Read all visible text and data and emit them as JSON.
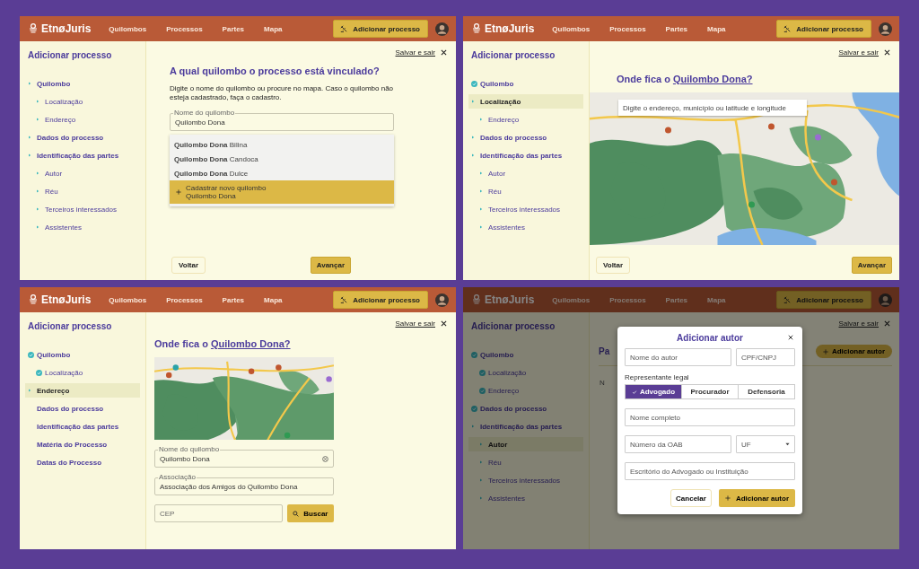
{
  "screens": [
    {
      "dimmed": false,
      "header": {
        "logo": "EtnøJuris",
        "nav": [
          "Quilombos",
          "Processos",
          "Partes",
          "Mapa"
        ],
        "action": "Adicionar processo"
      },
      "sidebar": {
        "title": "Adicionar processo",
        "steps": [
          {
            "label": "Quilombo",
            "kind": "pending",
            "selected": false,
            "children": [
              {
                "label": "Localização",
                "kind": "pending",
                "selected": false
              },
              {
                "label": "Endereço",
                "kind": "pending",
                "selected": false
              }
            ]
          },
          {
            "label": "Dados do processo",
            "kind": "pending",
            "selected": false
          },
          {
            "label": "Identificação das partes",
            "kind": "pending",
            "selected": false,
            "children": [
              {
                "label": "Autor",
                "kind": "pending",
                "selected": false
              },
              {
                "label": "Réu",
                "kind": "pending",
                "selected": false
              },
              {
                "label": "Terceiros interessados",
                "kind": "pending",
                "selected": false
              },
              {
                "label": "Assistentes",
                "kind": "pending",
                "selected": false
              }
            ]
          }
        ]
      },
      "save_exit": "Salvar e sair",
      "content": {
        "kind": "search",
        "heading": "A qual quilombo o processo está vinculado?",
        "description": "Digite o nome do quilombo ou procure no mapa. Caso o quilombo não esteja cadastrado, faça o cadastro.",
        "field": {
          "label": "Nome do quilombo",
          "value": "Quilombo Dona"
        },
        "suggestions": [
          "**Quilombo Dona** Bilina",
          "**Quilombo Dona** Candoca",
          "**Quilombo Dona** Dulce"
        ],
        "create": {
          "caption": "Cadastrar novo quilombo",
          "value": "Quilombo Dona"
        },
        "back": "Voltar",
        "next": "Avançar"
      }
    },
    {
      "dimmed": false,
      "header": {
        "logo": "EtnøJuris",
        "nav": [
          "Quilombos",
          "Processos",
          "Partes",
          "Mapa"
        ],
        "action": "Adicionar processo"
      },
      "sidebar": {
        "title": "Adicionar processo",
        "steps": [
          {
            "label": "Quilombo",
            "kind": "done",
            "selected": false
          },
          {
            "label": "Localização",
            "kind": "pending",
            "selected": true,
            "children": [
              {
                "label": "Endereço",
                "kind": "pending",
                "selected": false
              }
            ]
          },
          {
            "label": "Dados do processo",
            "kind": "pending",
            "selected": false
          },
          {
            "label": "Identificação das partes",
            "kind": "pending",
            "selected": false,
            "children": [
              {
                "label": "Autor",
                "kind": "pending",
                "selected": false
              },
              {
                "label": "Réu",
                "kind": "pending",
                "selected": false
              },
              {
                "label": "Terceiros interessados",
                "kind": "pending",
                "selected": false
              },
              {
                "label": "Assistentes",
                "kind": "pending",
                "selected": false
              }
            ]
          }
        ]
      },
      "save_exit": "Salvar e sair",
      "content": {
        "kind": "map",
        "heading": "Onde fica o",
        "link": "Quilombo Dona?",
        "map_search": {
          "placeholder": "Digite o endereço, município ou latitude e longitude"
        },
        "back": "Voltar",
        "next": "Avançar"
      }
    },
    {
      "dimmed": false,
      "header": {
        "logo": "EtnøJuris",
        "nav": [
          "Quilombos",
          "Processos",
          "Partes",
          "Mapa"
        ],
        "action": "Adicionar processo"
      },
      "sidebar": {
        "title": "Adicionar processo",
        "steps": [
          {
            "label": "Quilombo",
            "kind": "done",
            "selected": false,
            "children": [
              {
                "label": "Localização",
                "kind": "done",
                "selected": false
              }
            ]
          },
          {
            "label": "Endereço",
            "kind": "pending",
            "selected": true
          },
          {
            "label": "Dados do processo",
            "kind": "plain",
            "selected": false
          },
          {
            "label": "Identificação das partes",
            "kind": "plain",
            "selected": false
          },
          {
            "label": "Matéria do Processo",
            "kind": "plain",
            "selected": false
          },
          {
            "label": "Datas do Processo",
            "kind": "plain",
            "selected": false
          }
        ]
      },
      "save_exit": "Salvar e sair",
      "content": {
        "kind": "address",
        "heading": "Onde fica o",
        "link": "Quilombo Dona?",
        "name_field": {
          "label": "Nome do quilombo",
          "value": "Quilombo Dona"
        },
        "association_field": {
          "label": "Associação",
          "value": "Associação dos Amigos do Quilombo Dona"
        },
        "cep_field": {
          "placeholder": "CEP"
        },
        "search_button": "Buscar"
      }
    },
    {
      "dimmed": true,
      "header": {
        "logo": "EtnøJuris",
        "nav": [
          "Quilombos",
          "Processos",
          "Partes",
          "Mapa"
        ],
        "action": "Adicionar processo"
      },
      "sidebar": {
        "title": "Adicionar processo",
        "steps": [
          {
            "label": "Quilombo",
            "kind": "done",
            "selected": false,
            "children": [
              {
                "label": "Localização",
                "kind": "done",
                "selected": false
              },
              {
                "label": "Endereço",
                "kind": "done",
                "selected": false
              }
            ]
          },
          {
            "label": "Dados do processo",
            "kind": "done",
            "selected": false
          },
          {
            "label": "Identificação das partes",
            "kind": "pending",
            "selected": false,
            "children": [
              {
                "label": "Autor",
                "kind": "pending",
                "selected": true
              },
              {
                "label": "Réu",
                "kind": "pending",
                "selected": false
              },
              {
                "label": "Terceiros interessados",
                "kind": "pending",
                "selected": false
              },
              {
                "label": "Assistentes",
                "kind": "pending",
                "selected": false
              }
            ]
          }
        ]
      },
      "save_exit": "Salvar e sair",
      "content": {
        "kind": "parties",
        "heading": "Pa",
        "add_button": "Adicionar autor",
        "note": "N",
        "dialog": {
          "title": "Adicionar autor",
          "author_field": {
            "placeholder": "Nome do autor"
          },
          "document_field": {
            "placeholder": "CPF/CNPJ"
          },
          "group_label": "Representante legal",
          "options": [
            {
              "label": "Advogado",
              "selected": true
            },
            {
              "label": "Procurador",
              "selected": false
            },
            {
              "label": "Defensoria",
              "selected": false
            }
          ],
          "name_field": {
            "placeholder": "Nome completo"
          },
          "oab_field": {
            "placeholder": "Número da OAB"
          },
          "uf_select": {
            "placeholder": "UF"
          },
          "office_field": {
            "placeholder": "Escritório do Advogado ou Instituição"
          },
          "cancel": "Cancelar",
          "confirm": "Adicionar autor"
        }
      }
    }
  ]
}
